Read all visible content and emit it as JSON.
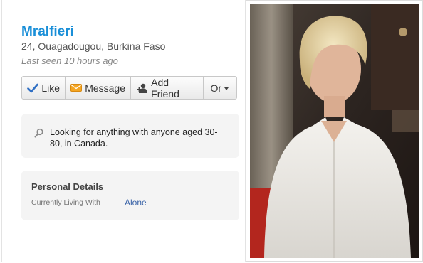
{
  "profile": {
    "name": "Mralfieri",
    "location": "24, Ouagadougou, Burkina Faso",
    "last_seen": "Last seen 10 hours ago"
  },
  "actions": {
    "like": "Like",
    "message": "Message",
    "add_friend": "Add Friend",
    "or": "Or"
  },
  "looking_for": {
    "icon": "search-icon",
    "text": "Looking for anything with anyone aged 30-80, in Canada."
  },
  "personal_details": {
    "heading": "Personal Details",
    "fields": [
      {
        "label": "Currently Living With",
        "value": "Alone"
      }
    ]
  },
  "colors": {
    "name": "#1a8fd8",
    "link": "#3b64a8",
    "panel": "#f4f4f4"
  }
}
